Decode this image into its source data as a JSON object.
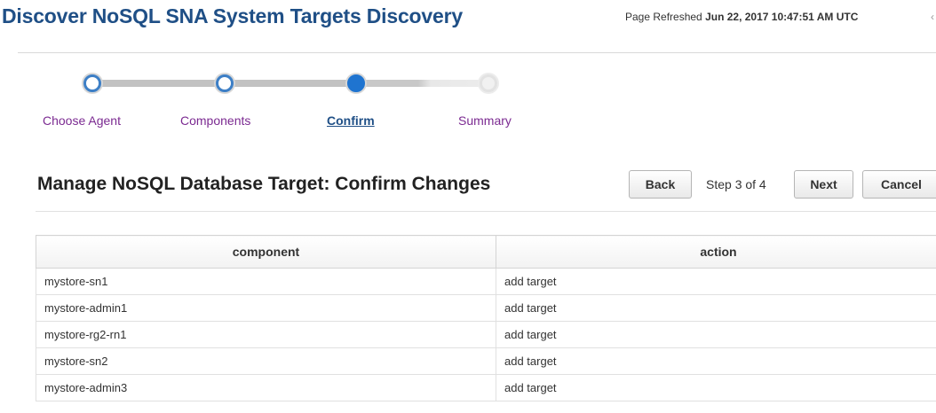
{
  "header": {
    "title": "Discover NoSQL SNA System Targets Discovery",
    "refresh_label": "Page Refreshed",
    "refresh_time": "Jun 22, 2017 10:47:51 AM UTC",
    "refresh_tail": "‹"
  },
  "train": {
    "steps": [
      {
        "label": "Choose Agent",
        "state": "visited"
      },
      {
        "label": "Components",
        "state": "visited"
      },
      {
        "label": "Confirm",
        "state": "current"
      },
      {
        "label": "Summary",
        "state": "future"
      }
    ]
  },
  "section": {
    "title": "Manage NoSQL Database Target: Confirm Changes",
    "back_label": "Back",
    "step_text": "Step 3 of 4",
    "next_label": "Next",
    "cancel_label": "Cancel"
  },
  "table": {
    "columns": [
      "component",
      "action"
    ],
    "rows": [
      {
        "component": "mystore-sn1",
        "action": "add target"
      },
      {
        "component": "mystore-admin1",
        "action": "add target"
      },
      {
        "component": "mystore-rg2-rn1",
        "action": "add target"
      },
      {
        "component": "mystore-sn2",
        "action": "add target"
      },
      {
        "component": "mystore-admin3",
        "action": "add target"
      }
    ]
  }
}
